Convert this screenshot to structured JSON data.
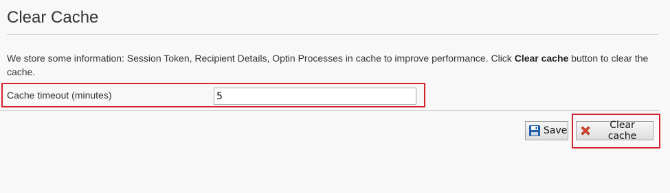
{
  "page": {
    "title": "Clear Cache",
    "description_pre": "We store some information: Session Token, Recipient Details, Optin Processes in cache to improve performance. Click ",
    "description_bold": "Clear cache",
    "description_post": " button to clear the cache."
  },
  "form": {
    "cache_timeout_label": "Cache timeout (minutes)",
    "cache_timeout_value": "5"
  },
  "actions": {
    "save_label": "Save",
    "clear_cache_label": "Clear cache"
  },
  "colors": {
    "highlight": "#d2232a",
    "save_icon": "#1f5fa8",
    "clear_icon": "#e0452b"
  },
  "icons": {
    "save": "floppy-disk-icon",
    "clear": "red-x-icon"
  }
}
